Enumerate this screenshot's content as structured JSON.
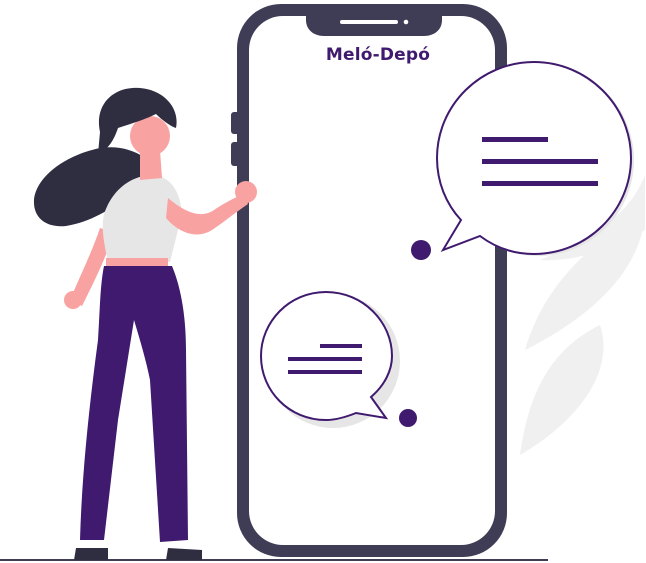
{
  "app": {
    "brand_name": "Meló-Depó"
  },
  "colors": {
    "accent": "#3f1a6e",
    "phone_frame": "#3f3d56",
    "hair": "#2f2e41",
    "skin": "#f9a2a2",
    "shirt": "#e6e6e6",
    "trousers": "#3f1a6e",
    "decor_leaf": "#f0f0f0",
    "bubble_shadow": "#e6e6e6"
  },
  "icons": {
    "chat_bubble_large": "speech-bubble-icon",
    "chat_bubble_small": "speech-bubble-icon",
    "leaf_decoration": "leaf-icon"
  }
}
